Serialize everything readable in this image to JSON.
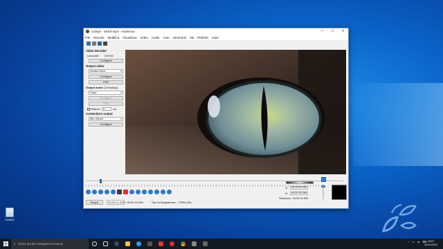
{
  "window": {
    "title": "Catsye - 4844f.mp4 - Avidemux",
    "minimize": "—",
    "maximize": "☐",
    "close": "✕"
  },
  "menu": [
    "File",
    "Recenti",
    "Modifica",
    "Visualizza",
    "Video",
    "Audio",
    "Auto",
    "Strumenti",
    "Vai",
    "Preferiti",
    "Aiuto"
  ],
  "left_panel": {
    "video_decoder": {
      "title": "Video Decoder",
      "lavcodec_label": "Lavcodec",
      "lavcodec_value": "DXV62",
      "configure": "Configura"
    },
    "video_output": {
      "title": "Output video",
      "codec": "Nvidia H264",
      "configure": "Configura",
      "filters": "Filtri"
    },
    "audio_output": {
      "title": "Output audio",
      "tracks": "(0 track(s))",
      "codec": "Copy",
      "configure": "Configura",
      "filters": "Filtri",
      "shift_label": "Ritardo:",
      "shift_value": "0",
      "shift_unit": "ms"
    },
    "container": {
      "title": "Contenitore output",
      "format": "Mkv Muxer",
      "configure": "Configura"
    }
  },
  "time": {
    "button": "Tempo:",
    "current": "00:00:01.234",
    "total": "/ 00:00:15.269",
    "frame_type_label": "Tipo di fotogramma:",
    "frame_type_value": "I-FRM (00)"
  },
  "selection": {
    "a_label": "A:",
    "a_value": "00:00:00.000",
    "b_label": "B:",
    "b_value": "00:00:15.269",
    "sel_label": "Selezione:",
    "sel_value": "00:00:15.269"
  },
  "desktop": {
    "recycle_bin": "Cestino"
  },
  "taskbar": {
    "search_placeholder": "Scrivi qui per eseguire la ricerca",
    "time": "18:07",
    "date": "30/11/2020"
  },
  "colors": {
    "accent": "#3a7fd0",
    "title_bar": "#ffffff",
    "taskbar": "#121a26"
  }
}
